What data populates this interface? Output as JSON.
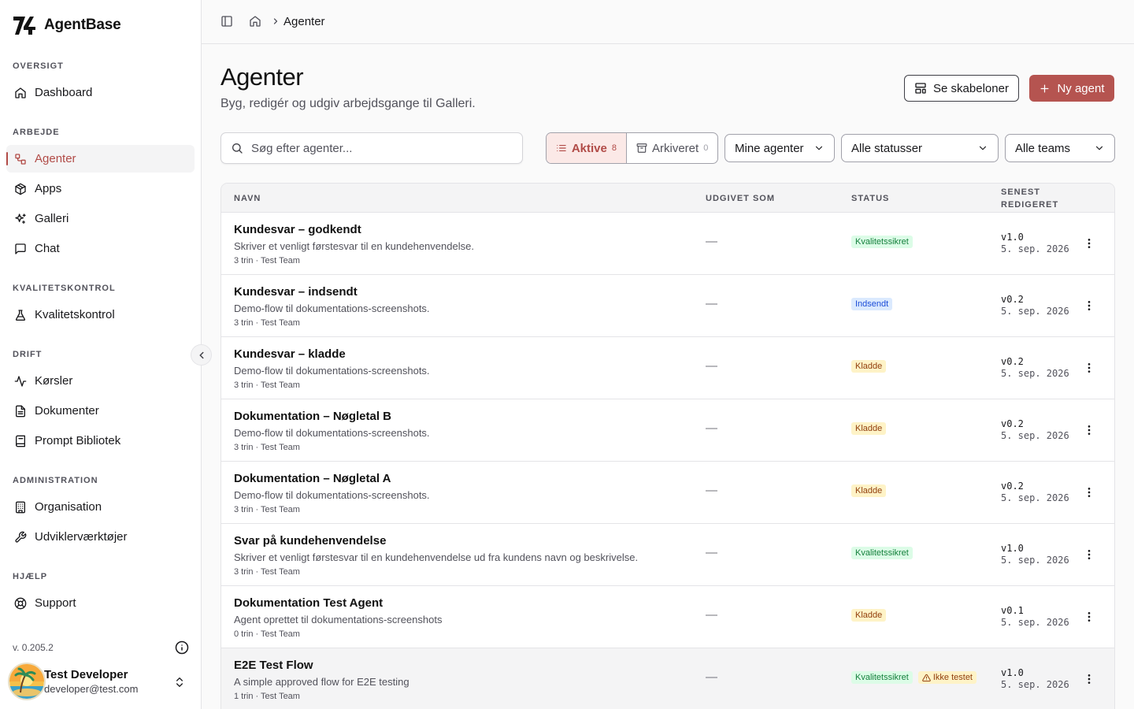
{
  "app": {
    "name": "AgentBase",
    "version": "v. 0.205.2"
  },
  "sidebar": {
    "sections": [
      {
        "label": "OVERSIGT"
      },
      {
        "label": "ARBEJDE"
      },
      {
        "label": "KVALITETSKONTROL"
      },
      {
        "label": "DRIFT"
      },
      {
        "label": "ADMINISTRATION"
      },
      {
        "label": "HJÆLP"
      }
    ],
    "items": {
      "dashboard": {
        "label": "Dashboard",
        "icon": "home-icon"
      },
      "agenter": {
        "label": "Agenter",
        "icon": "workflow-icon",
        "active": true
      },
      "apps": {
        "label": "Apps",
        "icon": "package-icon"
      },
      "galleri": {
        "label": "Galleri",
        "icon": "sparkles-icon"
      },
      "chat": {
        "label": "Chat",
        "icon": "message-square-icon"
      },
      "kvalitetskontrol": {
        "label": "Kvalitetskontrol",
        "icon": "flask-icon"
      },
      "korsler": {
        "label": "Kørsler",
        "icon": "activity-icon"
      },
      "dokumenter": {
        "label": "Dokumenter",
        "icon": "file-text-icon"
      },
      "prompt": {
        "label": "Prompt Bibliotek",
        "icon": "book-icon"
      },
      "organisation": {
        "label": "Organisation",
        "icon": "building-icon"
      },
      "udvikler": {
        "label": "Udviklerværktøjer",
        "icon": "wrench-icon"
      },
      "support": {
        "label": "Support",
        "icon": "life-buoy-icon"
      }
    }
  },
  "user": {
    "name": "Test Developer",
    "email": "developer@test.com"
  },
  "breadcrumb": {
    "current": "Agenter"
  },
  "page": {
    "title": "Agenter",
    "subtitle": "Byg, redigér og udgiv arbejdsgange til Galleri.",
    "templates_button": "Se skabeloner",
    "new_button": "Ny agent"
  },
  "filters": {
    "search_placeholder": "Søg efter agenter...",
    "active_label": "Aktive",
    "active_count": "8",
    "archived_label": "Arkiveret",
    "archived_count": "0",
    "owner": "Mine agenter",
    "status": "Alle statusser",
    "teams": "Alle teams"
  },
  "table": {
    "headers": {
      "name": "NAVN",
      "published": "UDGIVET SOM",
      "status": "STATUS",
      "edited_1": "SENEST",
      "edited_2": "REDIGERET"
    },
    "rows": [
      {
        "title": "Kundesvar – godkendt",
        "desc": "Skriver et venligt førstesvar til en kundehenvendelse.",
        "meta": "3 trin · Test Team",
        "published": "—",
        "status": "Kvalitetssikret",
        "status_kind": "green",
        "version": "v1.0",
        "date": "5. sep. 2026"
      },
      {
        "title": "Kundesvar – indsendt",
        "desc": "Demo-flow til dokumentations-screenshots.",
        "meta": "3 trin · Test Team",
        "published": "—",
        "status": "Indsendt",
        "status_kind": "blue",
        "version": "v0.2",
        "date": "5. sep. 2026"
      },
      {
        "title": "Kundesvar – kladde",
        "desc": "Demo-flow til dokumentations-screenshots.",
        "meta": "3 trin · Test Team",
        "published": "—",
        "status": "Kladde",
        "status_kind": "yellow",
        "version": "v0.2",
        "date": "5. sep. 2026"
      },
      {
        "title": "Dokumentation – Nøgletal B",
        "desc": "Demo-flow til dokumentations-screenshots.",
        "meta": "3 trin · Test Team",
        "published": "—",
        "status": "Kladde",
        "status_kind": "yellow",
        "version": "v0.2",
        "date": "5. sep. 2026"
      },
      {
        "title": "Dokumentation – Nøgletal A",
        "desc": "Demo-flow til dokumentations-screenshots.",
        "meta": "3 trin · Test Team",
        "published": "—",
        "status": "Kladde",
        "status_kind": "yellow",
        "version": "v0.2",
        "date": "5. sep. 2026"
      },
      {
        "title": "Svar på kundehenvendelse",
        "desc": "Skriver et venligt førstesvar til en kundehenvendelse ud fra kundens navn og beskrivelse.",
        "meta": "3 trin · Test Team",
        "published": "—",
        "status": "Kvalitetssikret",
        "status_kind": "green",
        "version": "v1.0",
        "date": "5. sep. 2026"
      },
      {
        "title": "Dokumentation Test Agent",
        "desc": "Agent oprettet til dokumentations-screenshots",
        "meta": "0 trin · Test Team",
        "published": "—",
        "status": "Kladde",
        "status_kind": "yellow",
        "version": "v0.1",
        "date": "5. sep. 2026"
      },
      {
        "title": "E2E Test Flow",
        "desc": "A simple approved flow for E2E testing",
        "meta": "1 trin · Test Team",
        "published": "—",
        "status": "Kvalitetssikret",
        "status_kind": "green",
        "extra_badge": "Ikke testet",
        "version": "v1.0",
        "date": "5. sep. 2026"
      }
    ]
  },
  "colors": {
    "accent": "#b55450",
    "active_text": "#b14b47"
  }
}
